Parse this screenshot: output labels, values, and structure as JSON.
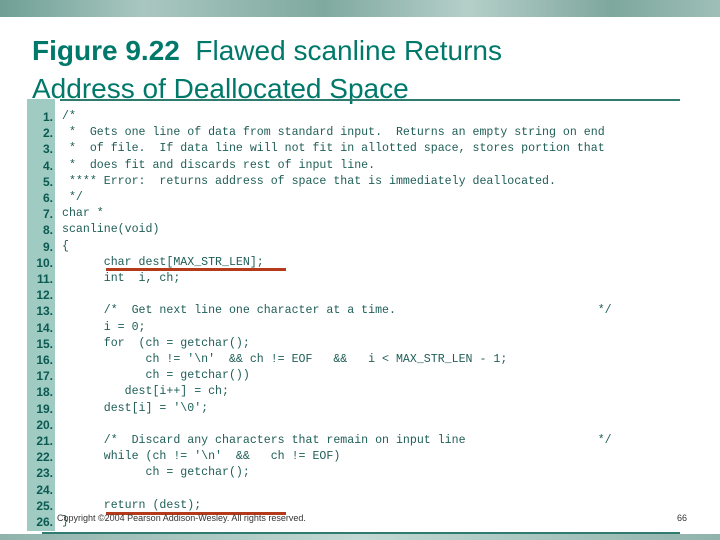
{
  "title": {
    "figure": "Figure 9.22",
    "line1": "Flawed scanline Returns",
    "line2": "Address of Deallocated Space"
  },
  "code": {
    "line_numbers": [
      "1.",
      "2.",
      "3.",
      "4.",
      "5.",
      "6.",
      "7.",
      "8.",
      "9.",
      "10.",
      "11.",
      "12.",
      "13.",
      "14.",
      "15.",
      "16.",
      "17.",
      "18.",
      "19.",
      "20.",
      "21.",
      "22.",
      "23.",
      "24.",
      "25.",
      "26."
    ],
    "text": "/*\n *  Gets one line of data from standard input.  Returns an empty string on end\n *  of file.  If data line will not fit in allotted space, stores portion that\n *  does fit and discards rest of input line.\n **** Error:  returns address of space that is immediately deallocated.\n */\nchar *\nscanline(void)\n{\n      char dest[MAX_STR_LEN];\n      int  i, ch;\n\n      /*  Get next line one character at a time.                             */\n      i = 0;\n      for  (ch = getchar();\n            ch != '\\n'  && ch != EOF   &&   i < MAX_STR_LEN - 1;\n            ch = getchar())\n         dest[i++] = ch;\n      dest[i] = '\\0';\n\n      /*  Discard any characters that remain on input line                   */\n      while (ch != '\\n'  &&   ch != EOF)\n            ch = getchar();\n\n      return (dest);\n}",
    "highlight_color": "#b53a1a"
  },
  "footer": {
    "copyright": "Copyright ©2004 Pearson Addison-Wesley. All rights reserved.",
    "page": "66"
  },
  "colors": {
    "accent": "#00786a",
    "gutter": "#9fcbc3"
  }
}
